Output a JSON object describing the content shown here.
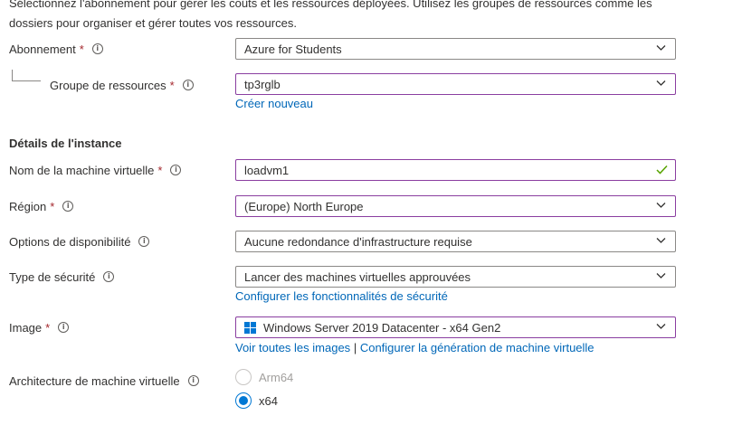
{
  "intro": {
    "line1": "Sélectionnez l'abonnement pour gérer les coûts et les ressources déployées. Utilisez les groupes de ressources comme les",
    "line2": "dossiers pour organiser et gérer toutes vos ressources."
  },
  "required_mark": "*",
  "subscription": {
    "label": "Abonnement",
    "value": "Azure for Students"
  },
  "resource_group": {
    "label": "Groupe de ressources",
    "value": "tp3rglb",
    "create_link": "Créer nouveau"
  },
  "instance_heading": "Détails de l'instance",
  "vm_name": {
    "label": "Nom de la machine virtuelle",
    "value": "loadvm1"
  },
  "region": {
    "label": "Région",
    "value": "(Europe) North Europe"
  },
  "availability": {
    "label": "Options de disponibilité",
    "value": "Aucune redondance d'infrastructure requise"
  },
  "security_type": {
    "label": "Type de sécurité",
    "value": "Lancer des machines virtuelles approuvées",
    "link": "Configurer les fonctionnalités de sécurité"
  },
  "image": {
    "label": "Image",
    "value": "Windows Server 2019 Datacenter - x64 Gen2",
    "icon": "windows-logo-icon",
    "link_all": "Voir toutes les images",
    "separator": "|",
    "link_generation": "Configurer la génération de machine virtuelle"
  },
  "architecture": {
    "label": "Architecture de machine virtuelle",
    "options": [
      {
        "label": "Arm64",
        "selected": false,
        "disabled": true
      },
      {
        "label": "x64",
        "selected": true,
        "disabled": false
      }
    ]
  },
  "colors": {
    "link": "#0067b8",
    "focus_border": "#8a3ea0",
    "required": "#a4262c",
    "valid_check": "#57a300",
    "radio_selected": "#0078d4"
  }
}
